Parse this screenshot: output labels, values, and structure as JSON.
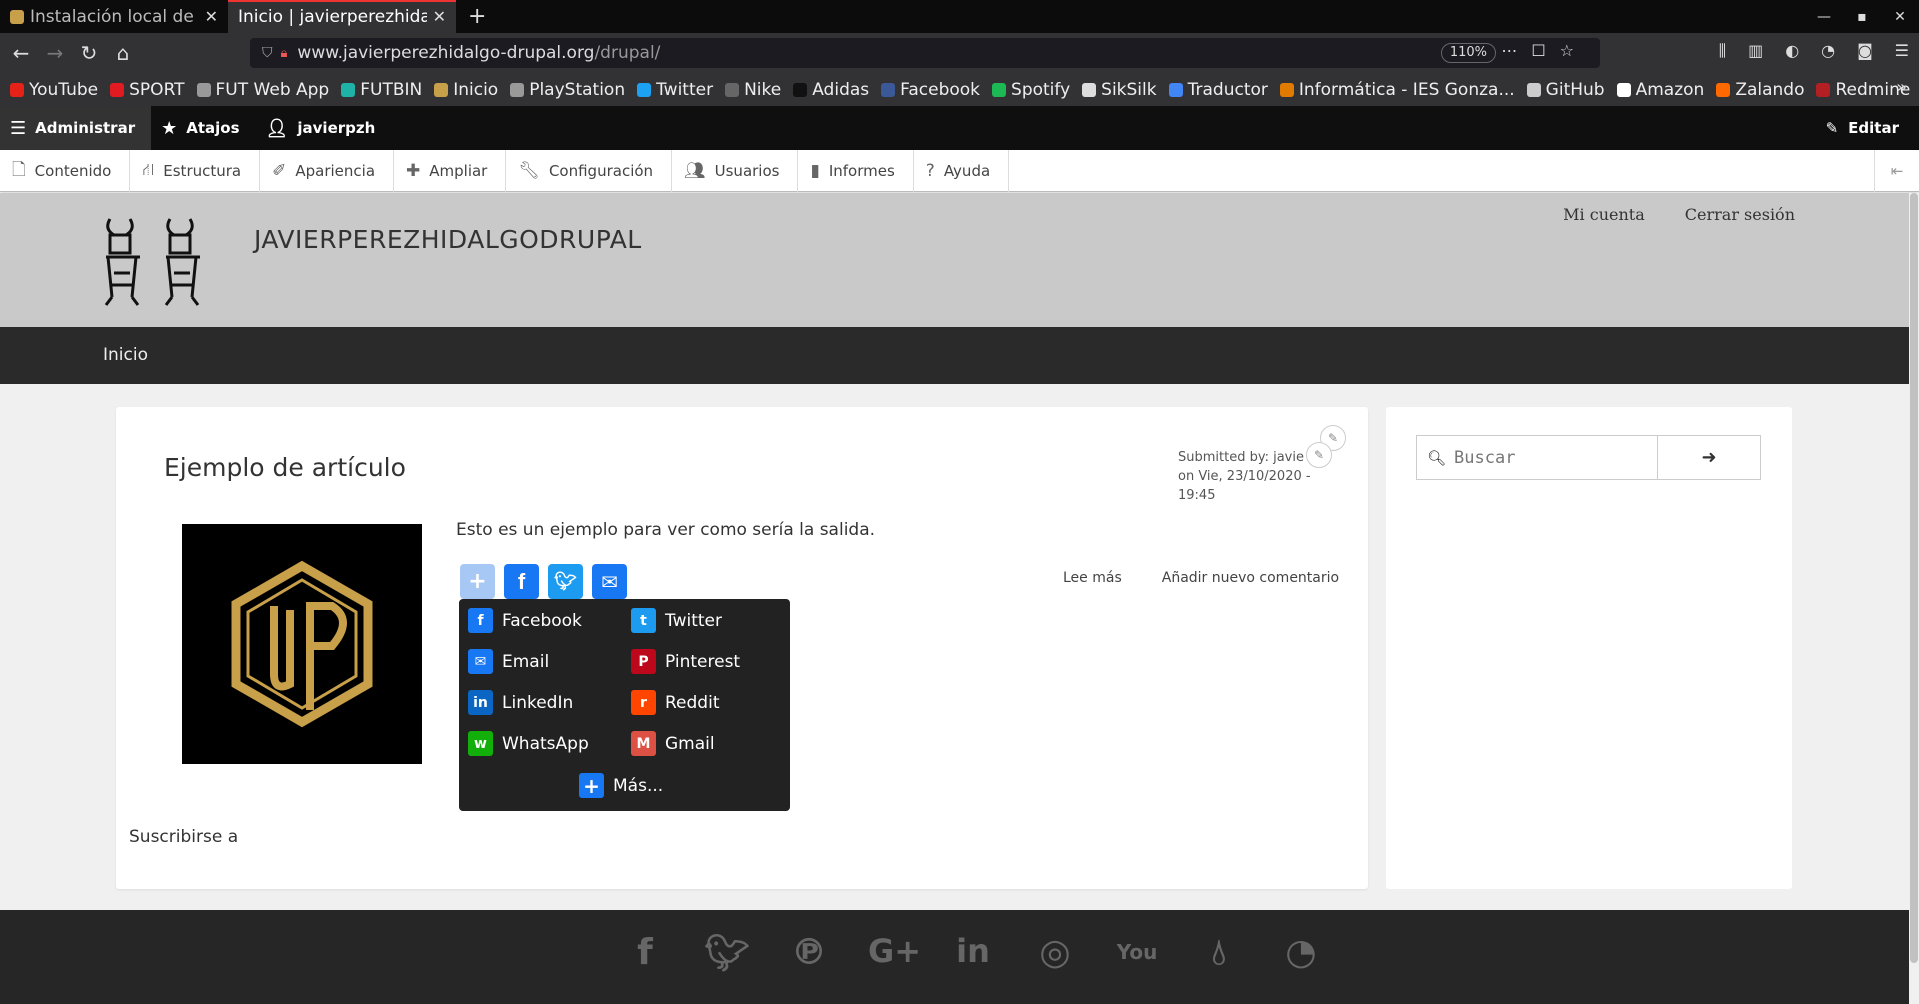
{
  "browser": {
    "tabs": [
      {
        "title": "Instalación local de un"
      },
      {
        "title": "Inicio | javierperezhidalgo"
      }
    ],
    "url_host": "www.javierperezhidalgo-drupal.org",
    "url_path": "/drupal/",
    "zoom": "110%",
    "bookmarks": [
      {
        "label": "YouTube",
        "color": "#e62117"
      },
      {
        "label": "SPORT",
        "color": "#e21b23"
      },
      {
        "label": "FUT Web App",
        "color": "#999999"
      },
      {
        "label": "FUTBIN",
        "color": "#1fb2a6"
      },
      {
        "label": "Inicio",
        "color": "#c9a04a"
      },
      {
        "label": "PlayStation",
        "color": "#999999"
      },
      {
        "label": "Twitter",
        "color": "#1da1f2"
      },
      {
        "label": "Nike",
        "color": "#666666"
      },
      {
        "label": "Adidas",
        "color": "#111111"
      },
      {
        "label": "Facebook",
        "color": "#3b5998"
      },
      {
        "label": "Spotify",
        "color": "#1db954"
      },
      {
        "label": "SikSilk",
        "color": "#dddddd"
      },
      {
        "label": "Traductor",
        "color": "#4285f4"
      },
      {
        "label": "Informática - IES Gonza...",
        "color": "#e07b00"
      },
      {
        "label": "GitHub",
        "color": "#cccccc"
      },
      {
        "label": "Amazon",
        "color": "#ffffff"
      },
      {
        "label": "Zalando",
        "color": "#ff6900"
      },
      {
        "label": "Redmine",
        "color": "#b32024"
      }
    ]
  },
  "admin": {
    "manage": "Administrar",
    "shortcuts": "Atajos",
    "user": "javierpzh",
    "edit": "Editar"
  },
  "tray": [
    "Contenido",
    "Estructura",
    "Apariencia",
    "Ampliar",
    "Configuración",
    "Usuarios",
    "Informes",
    "Ayuda"
  ],
  "site": {
    "name": "JAVIERPEREZHIDALGODRUPAL",
    "account": "Mi cuenta",
    "logout": "Cerrar sesión",
    "nav_home": "Inicio"
  },
  "article": {
    "title": "Ejemplo de artículo",
    "submitted_by": "Submitted by: javie",
    "submitted_on": "on Vie, 23/10/2020 - 19:45",
    "body": "Esto es un ejemplo para ver como sería la salida.",
    "read_more": "Lee más",
    "add_comment": "Añadir nuevo comentario",
    "subscribe": "Suscribirse a"
  },
  "share_menu": {
    "items": [
      {
        "label": "Facebook",
        "color": "#1877f2",
        "glyph": "f"
      },
      {
        "label": "Twitter",
        "color": "#1d9bf0",
        "glyph": "t"
      },
      {
        "label": "Email",
        "color": "#1877f2",
        "glyph": "✉"
      },
      {
        "label": "Pinterest",
        "color": "#bd081c",
        "glyph": "P"
      },
      {
        "label": "LinkedIn",
        "color": "#0a66c2",
        "glyph": "in"
      },
      {
        "label": "Reddit",
        "color": "#ff4500",
        "glyph": "r"
      },
      {
        "label": "WhatsApp",
        "color": "#12af0a",
        "glyph": "w"
      },
      {
        "label": "Gmail",
        "color": "#dd5144",
        "glyph": "M"
      }
    ],
    "more": "Más..."
  },
  "search": {
    "placeholder": "Buscar"
  }
}
